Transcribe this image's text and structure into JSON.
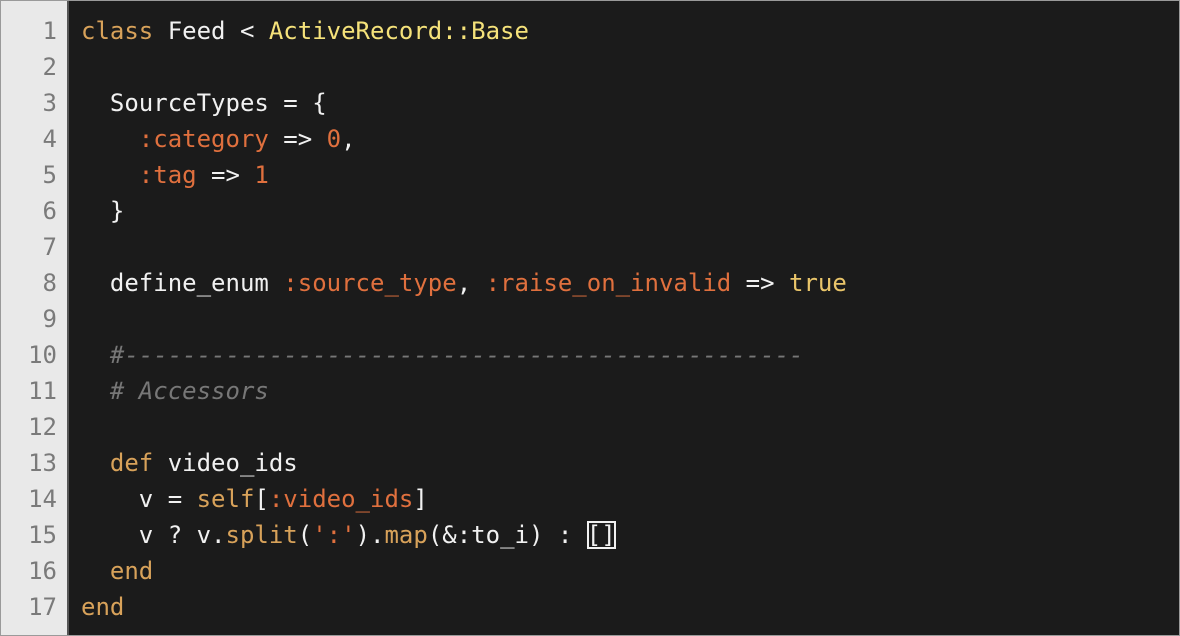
{
  "editor": {
    "line_numbers": [
      "1",
      "2",
      "3",
      "4",
      "5",
      "6",
      "7",
      "8",
      "9",
      "10",
      "11",
      "12",
      "13",
      "14",
      "15",
      "16",
      "17"
    ],
    "lines": [
      [
        {
          "t": "kw",
          "v": "class"
        },
        {
          "t": "plain",
          "v": " Feed < "
        },
        {
          "t": "const",
          "v": "ActiveRecord::Base"
        }
      ],
      [],
      [
        {
          "t": "plain",
          "v": "  SourceTypes = {"
        }
      ],
      [
        {
          "t": "plain",
          "v": "    "
        },
        {
          "t": "sym",
          "v": ":category"
        },
        {
          "t": "plain",
          "v": " => "
        },
        {
          "t": "num",
          "v": "0"
        },
        {
          "t": "plain",
          "v": ","
        }
      ],
      [
        {
          "t": "plain",
          "v": "    "
        },
        {
          "t": "sym",
          "v": ":tag"
        },
        {
          "t": "plain",
          "v": " => "
        },
        {
          "t": "num",
          "v": "1"
        }
      ],
      [
        {
          "t": "plain",
          "v": "  }"
        }
      ],
      [],
      [
        {
          "t": "plain",
          "v": "  define_enum "
        },
        {
          "t": "sym",
          "v": ":source_type"
        },
        {
          "t": "plain",
          "v": ", "
        },
        {
          "t": "sym",
          "v": ":raise_on_invalid"
        },
        {
          "t": "plain",
          "v": " => "
        },
        {
          "t": "bool",
          "v": "true"
        }
      ],
      [],
      [
        {
          "t": "cmt",
          "v": "  #-----------------------------------------------"
        }
      ],
      [
        {
          "t": "cmt",
          "v": "  # Accessors"
        }
      ],
      [],
      [
        {
          "t": "kw",
          "v": "  def"
        },
        {
          "t": "plain",
          "v": " video_ids"
        }
      ],
      [
        {
          "t": "plain",
          "v": "    v = "
        },
        {
          "t": "sel",
          "v": "self"
        },
        {
          "t": "plain",
          "v": "["
        },
        {
          "t": "sym",
          "v": ":video_ids"
        },
        {
          "t": "plain",
          "v": "]"
        }
      ],
      [
        {
          "t": "plain",
          "v": "    v ? v."
        },
        {
          "t": "meth",
          "v": "split"
        },
        {
          "t": "plain",
          "v": "("
        },
        {
          "t": "str",
          "v": "':'"
        },
        {
          "t": "plain",
          "v": ")."
        },
        {
          "t": "meth",
          "v": "map"
        },
        {
          "t": "plain",
          "v": "(&:to_i) : "
        },
        {
          "t": "box",
          "v": "[]"
        }
      ],
      [
        {
          "t": "kw",
          "v": "  end"
        }
      ],
      [
        {
          "t": "kw",
          "v": "end"
        }
      ]
    ]
  }
}
